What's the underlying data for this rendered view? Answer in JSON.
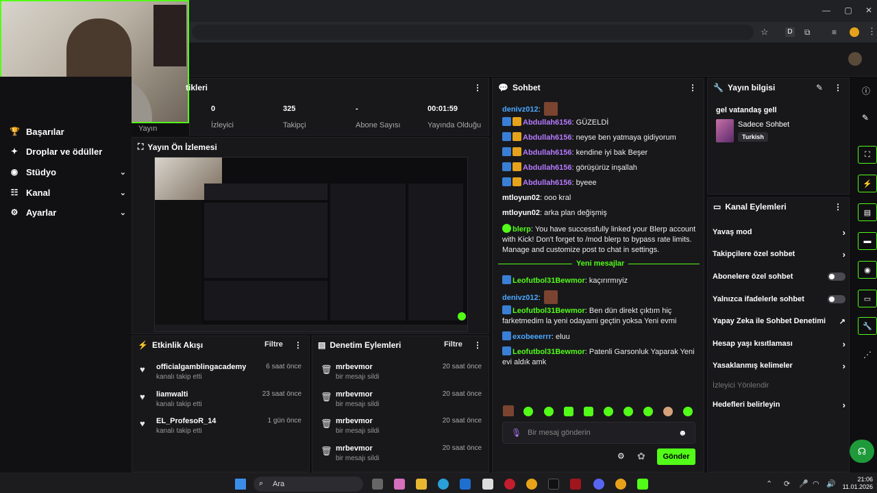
{
  "sidebar": {
    "items": [
      {
        "label": "Başarılar",
        "icon": "trophy-icon"
      },
      {
        "label": "Droplar ve ödüller",
        "icon": "gift-icon"
      },
      {
        "label": "Stüdyo",
        "icon": "studio-icon"
      },
      {
        "label": "Kanal",
        "icon": "users-icon"
      },
      {
        "label": "Ayarlar",
        "icon": "gear-icon"
      }
    ]
  },
  "stats_panel": {
    "title_partial": "tikleri",
    "items": [
      {
        "value": "",
        "label": "Yayın"
      },
      {
        "value": "0",
        "label": "İzleyici"
      },
      {
        "value": "325",
        "label": "Takipçi"
      },
      {
        "value": "-",
        "label": "Abone Sayısı"
      },
      {
        "value": "00:01:59",
        "label": "Yayında Olduğu"
      }
    ]
  },
  "preview": {
    "title": "Yayın Ön İzlemesi"
  },
  "activity": {
    "title": "Etkinlik Akışı",
    "filter": "Filtre",
    "rows": [
      {
        "name": "officialgamblingacademy",
        "sub": "kanalı takip etti",
        "time": "6 saat önce"
      },
      {
        "name": "liamwalti",
        "sub": "kanalı takip etti",
        "time": "23 saat önce"
      },
      {
        "name": "EL_ProfesoR_14",
        "sub": "kanalı takip etti",
        "time": "1 gün önce"
      }
    ]
  },
  "moderation": {
    "title": "Denetim Eylemleri",
    "filter": "Filtre",
    "rows": [
      {
        "name": "mrbevmor",
        "sub": "bir mesajı sildi",
        "time": "20 saat önce"
      },
      {
        "name": "mrbevmor",
        "sub": "bir mesajı sildi",
        "time": "20 saat önce"
      },
      {
        "name": "mrbevmor",
        "sub": "bir mesajı sildi",
        "time": "20 saat önce"
      },
      {
        "name": "mrbevmor",
        "sub": "bir mesajı sildi",
        "time": "20 saat önce"
      }
    ]
  },
  "chat": {
    "title": "Sohbet",
    "messages": [
      {
        "user": "denivz012",
        "text": ""
      },
      {
        "user": "Abdullah6156",
        "text": "GÜZELDİ"
      },
      {
        "user": "Abdullah6156",
        "text": "neyse ben yatmaya gidiyorum"
      },
      {
        "user": "Abdullah6156",
        "text": "kendine iyi bak Beşer"
      },
      {
        "user": "Abdullah6156",
        "text": "görüşürüz inşallah"
      },
      {
        "user": "Abdullah6156",
        "text": "byeee"
      },
      {
        "user": "mtloyun02",
        "text": "ooo kral"
      },
      {
        "user": "mtloyun02",
        "text": "arka plan değişmiş"
      },
      {
        "user": "blerp",
        "text": "You have successfully linked your Blerp account with Kick! Don't forget to /mod blerp to bypass rate limits. Manage and customize post to chat in settings."
      }
    ],
    "divider": "Yeni mesajlar",
    "new_messages": [
      {
        "user": "Leofutbol31Bewmor",
        "text": "kaçırırmıyiz"
      },
      {
        "user": "denivz012",
        "text": ""
      },
      {
        "user": "Leofutbol31Bewmor",
        "text": "Ben dün direkt çıktım hiç farketmedim la yeni odayami geçtin yoksa Yeni evmi"
      },
      {
        "user": "exobeeerrr",
        "text": "eluu"
      },
      {
        "user": "Leofutbol31Bewmor",
        "text": "Patenli Garsonluk Yaparak Yeni evi aldık amk"
      }
    ],
    "input_placeholder": "Bir mesaj gönderin",
    "send_label": "Gönder"
  },
  "stream_info": {
    "title": "Yayın bilgisi",
    "stream_title": "gel vatandaş gell",
    "category": "Sadece Sohbet",
    "tag": "Turkish"
  },
  "channel_actions": {
    "title": "Kanal Eylemleri",
    "rows": [
      {
        "label": "Yavaş mod",
        "control": "arrow"
      },
      {
        "label": "Takipçilere özel sohbet",
        "control": "arrow"
      },
      {
        "label": "Abonelere özel sohbet",
        "control": "toggle"
      },
      {
        "label": "Yalnızca ifadelerle sohbet",
        "control": "toggle"
      },
      {
        "label": "Yapay Zeka ile Sohbet Denetimi",
        "control": "external"
      },
      {
        "label": "Hesap yaşı kısıtlaması",
        "control": "arrow"
      },
      {
        "label": "Yasaklanmış kelimeler",
        "control": "arrow"
      }
    ],
    "section": "İzleyici Yönlendir",
    "goals": "Hedefleri belirleyin"
  },
  "taskbar": {
    "search": "Ara",
    "time": "21:06",
    "date": "11.01.2026"
  },
  "colors": {
    "accent": "#53fc18",
    "panel": "#18181b",
    "bg": "#0f0f11"
  }
}
